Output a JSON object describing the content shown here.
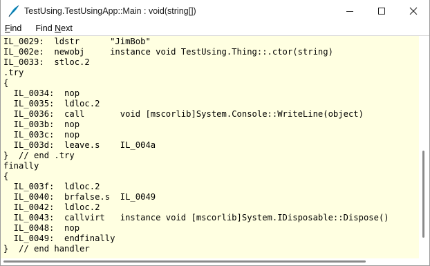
{
  "window": {
    "title": "TestUsing.TestUsingApp::Main : void(string[])",
    "app_icon": "quill-pen-icon"
  },
  "menu": {
    "find": {
      "label_pre": "",
      "underline": "F",
      "label_post": "ind"
    },
    "find_next": {
      "label_pre": "Find ",
      "underline": "N",
      "label_post": "ext"
    }
  },
  "code_lines": [
    "IL_0029:  ldstr      \"JimBob\"",
    "IL_002e:  newobj     instance void TestUsing.Thing::.ctor(string)",
    "IL_0033:  stloc.2",
    ".try",
    "{",
    "  IL_0034:  nop",
    "  IL_0035:  ldloc.2",
    "  IL_0036:  call       void [mscorlib]System.Console::WriteLine(object)",
    "  IL_003b:  nop",
    "  IL_003c:  nop",
    "  IL_003d:  leave.s    IL_004a",
    "}  // end .try",
    "finally",
    "{",
    "  IL_003f:  ldloc.2",
    "  IL_0040:  brfalse.s  IL_0049",
    "  IL_0042:  ldloc.2",
    "  IL_0043:  callvirt   instance void [mscorlib]System.IDisposable::Dispose()",
    "  IL_0048:  nop",
    "  IL_0049:  endfinally",
    "}  // end handler"
  ],
  "colors": {
    "content_background": "#ffffe1",
    "text": "#000000",
    "icon_accent": "#1aa3d9"
  }
}
